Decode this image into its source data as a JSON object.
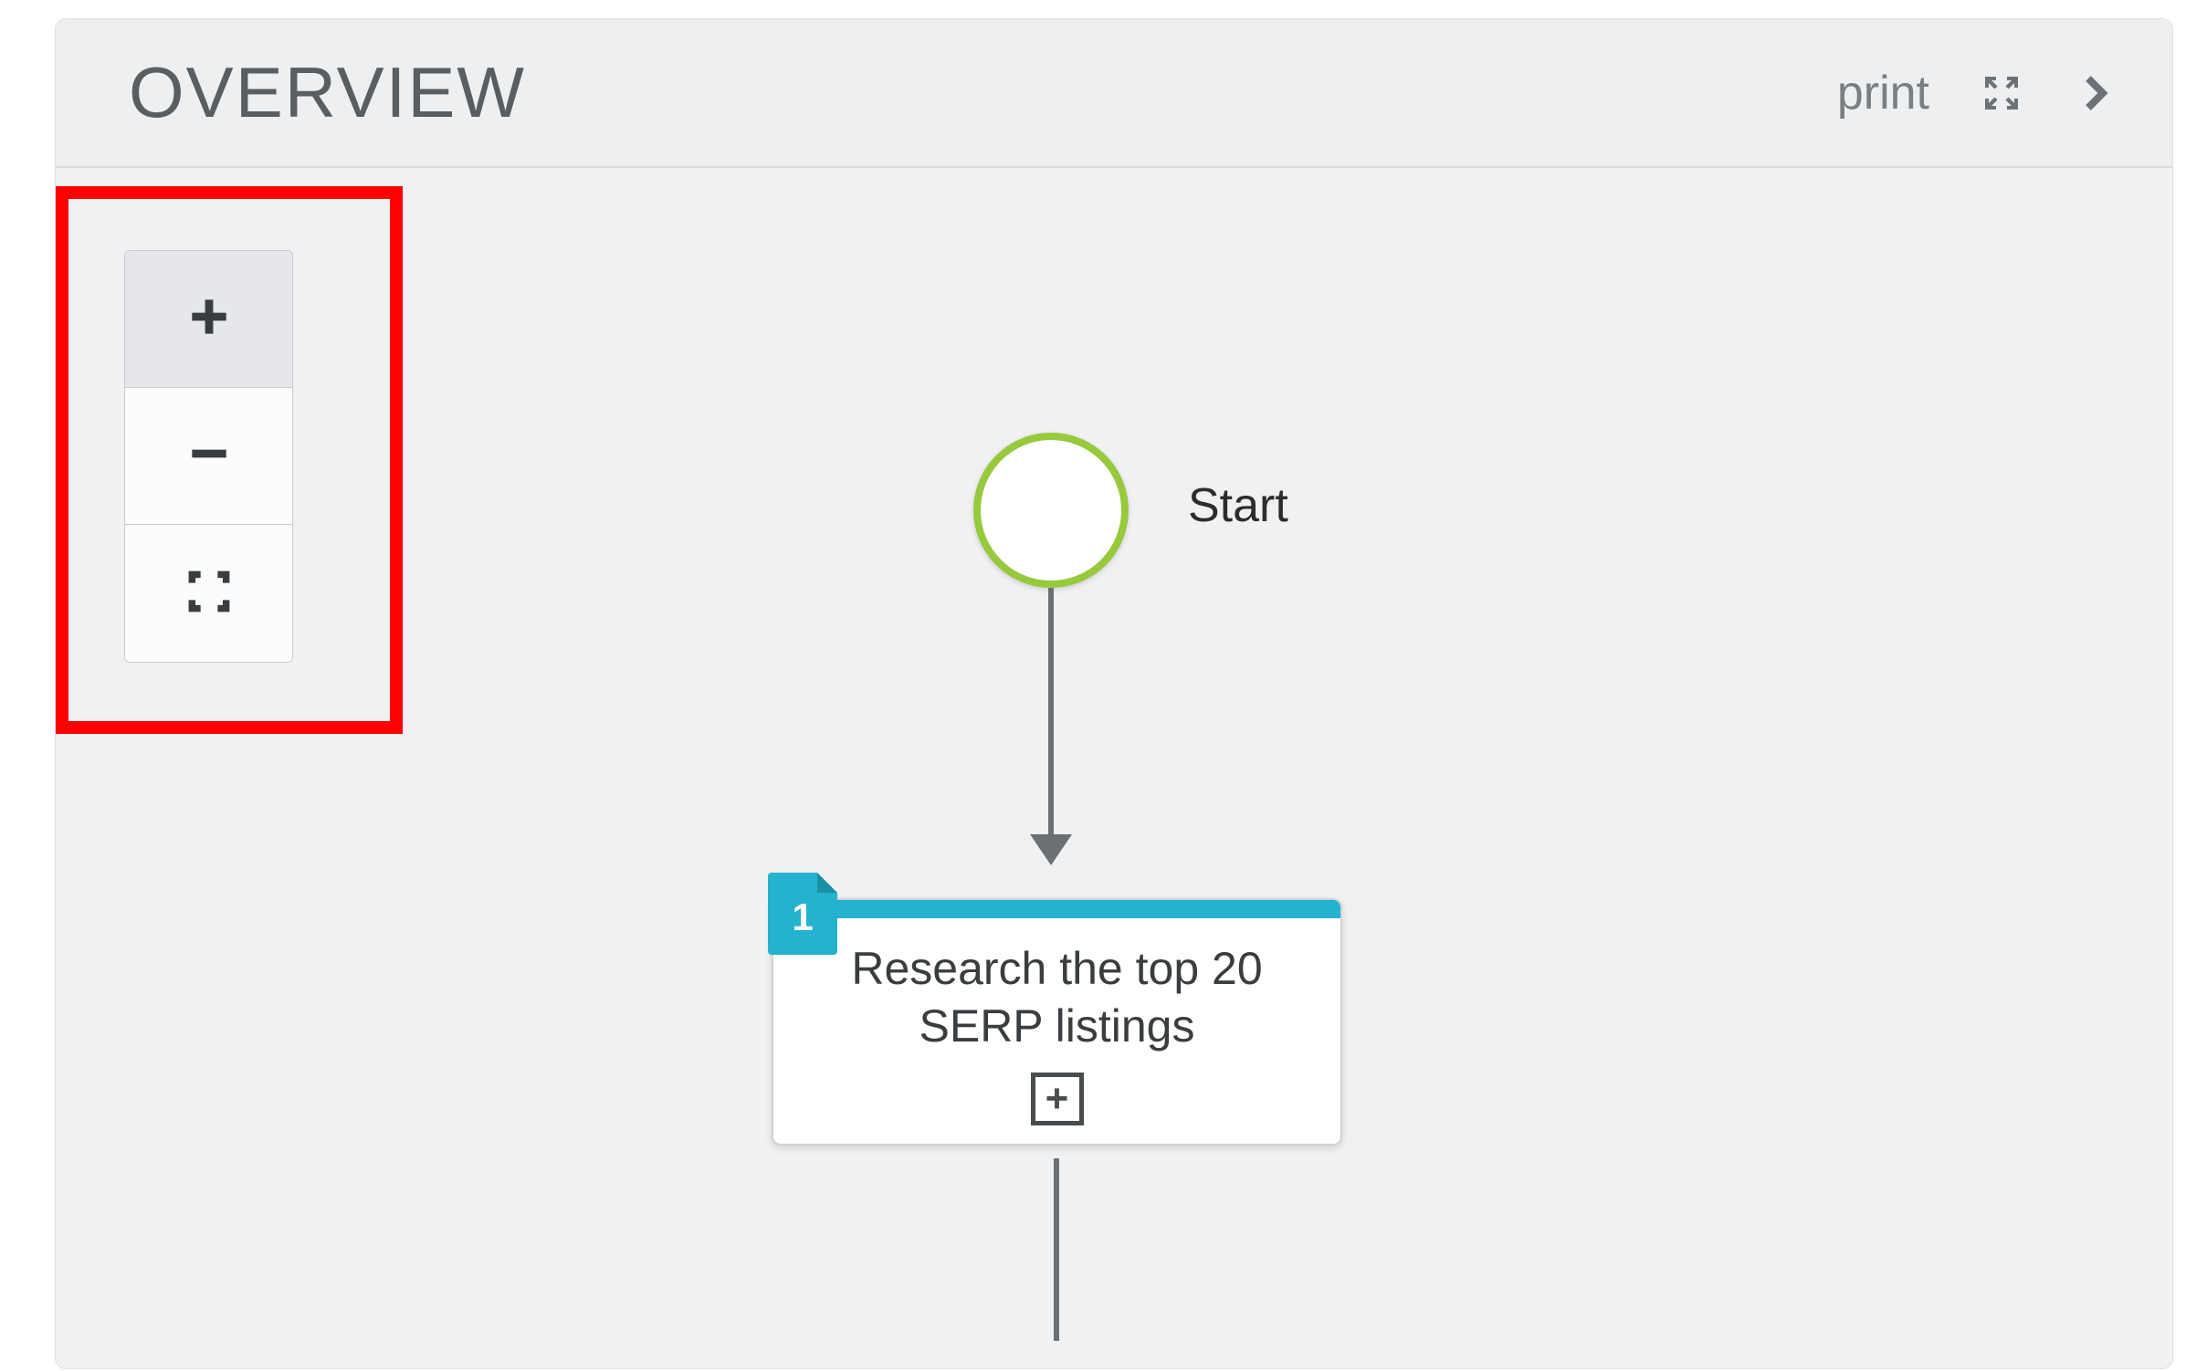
{
  "header": {
    "title": "OVERVIEW",
    "print_label": "print"
  },
  "flow": {
    "start_label": "Start",
    "nodes": [
      {
        "id": "1",
        "badge": "1",
        "text": "Research the top 20 SERP listings",
        "accent_color": "#24b2cf"
      }
    ]
  },
  "zoom": {
    "plus_icon": "plus",
    "minus_icon": "minus",
    "fit_icon": "fullscreen-target"
  },
  "highlight": {
    "target": "zoom-controls",
    "color": "#ff0000"
  }
}
